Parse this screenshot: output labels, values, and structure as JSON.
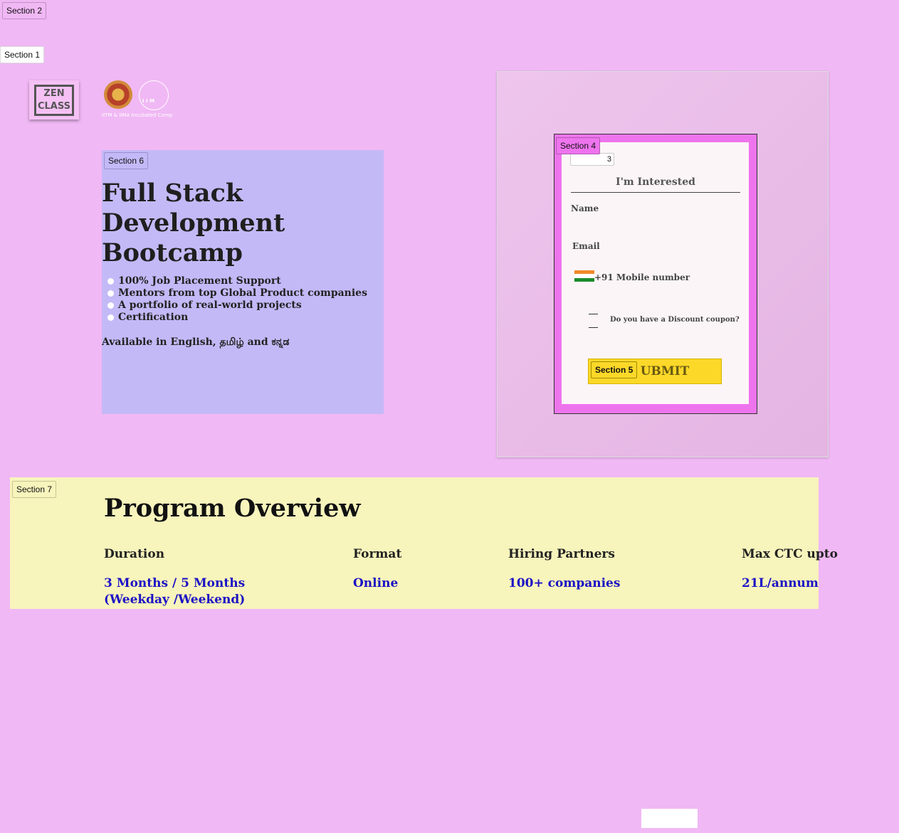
{
  "tags": {
    "section1": "Section 1",
    "section2": "Section 2",
    "section3": "3",
    "section4": "Section 4",
    "section5": "Section 5",
    "section6": "Section 6",
    "section7": "Section 7"
  },
  "header": {
    "logo_line1": "ZEN",
    "logo_line2": "CLASS",
    "seal2_text": "I I M",
    "incubated": "IITM & IIMA Incubated Comp"
  },
  "hero": {
    "title": "Full Stack Development Bootcamp",
    "bullets": [
      "100% Job Placement Support",
      "Mentors from top Global Product companies",
      "A portfolio of real-world projects",
      "Certification"
    ],
    "languages": "Available in English, தமிழ் and ಕನ್ನಡ"
  },
  "form": {
    "title": "I'm Interested",
    "name_label": "Name",
    "email_label": "Email",
    "phone_prefix": "+91",
    "phone_label": "+91  Mobile number",
    "coupon_label": "Do you have a Discount coupon?",
    "submit_label": "UBMIT"
  },
  "overview": {
    "title": "Program Overview",
    "columns": [
      {
        "heading": "Duration",
        "value": "3 Months / 5 Months (Weekday  /Weekend)"
      },
      {
        "heading": "Format",
        "value": "Online"
      },
      {
        "heading": "Hiring Partners",
        "value": "100+ companies"
      },
      {
        "heading": "Max CTC upto",
        "value": "21L/annum"
      }
    ]
  },
  "colors": {
    "page_bg": "#f0b8f4",
    "hero_bg": "#c4b9f7",
    "form_border": "#ee74ee",
    "submit_bg": "#fcd829",
    "overview_bg": "#f7f4bc",
    "value_text": "#1c12c4"
  }
}
